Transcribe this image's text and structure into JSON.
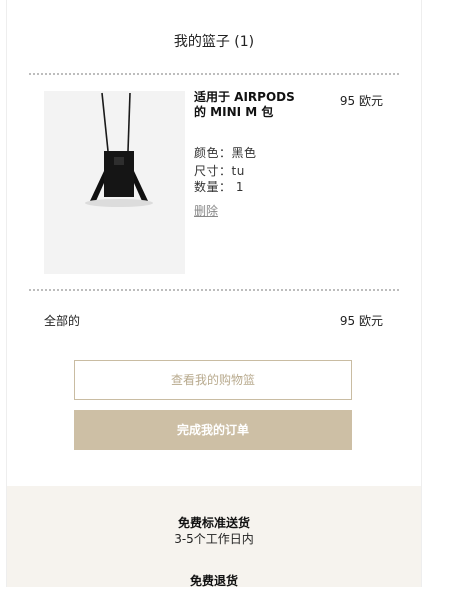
{
  "cart": {
    "title": "我的篮子 (1)",
    "item": {
      "name": "适用于 AIRPODS 的 MINI M 包",
      "price": "95 欧元",
      "color": "颜色：黑色",
      "size": "尺寸：tu",
      "quantity": "数量： 1",
      "remove_label": "删除",
      "image_icon": "bag-product-image"
    },
    "total_label": "全部的",
    "total_value": "95 欧元",
    "view_cart_label": "查看我的购物篮",
    "checkout_label": "完成我的订单"
  },
  "info": {
    "shipping_title": "免费标准送货",
    "shipping_time": "3-5个工作日内",
    "returns_title": "免费退货"
  },
  "colors": {
    "accent": "#cdbfa5",
    "outline_text": "#b8aa8e",
    "info_bg": "#f6f3ee"
  }
}
